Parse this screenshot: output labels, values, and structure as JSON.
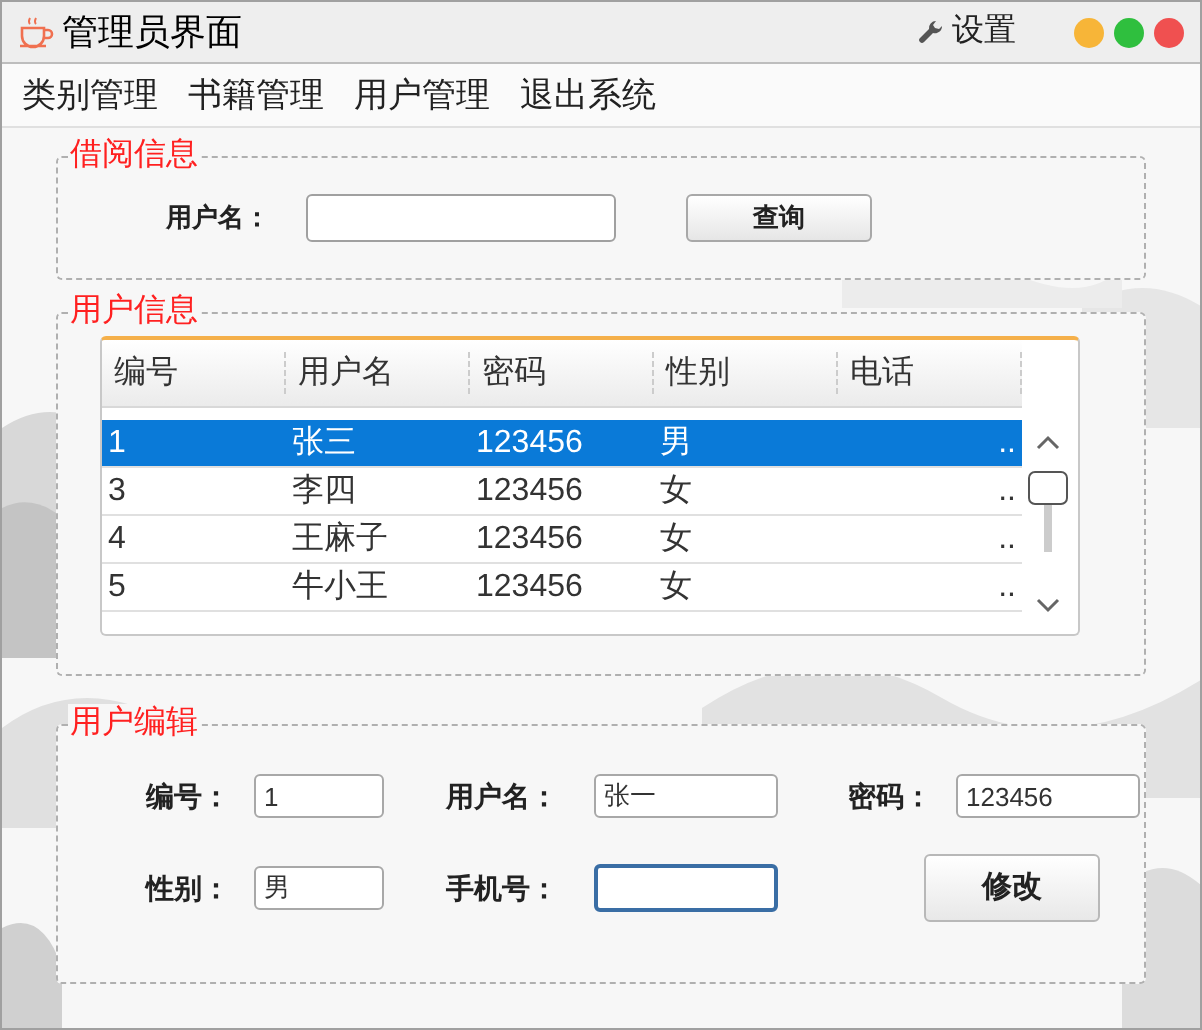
{
  "window": {
    "title": "管理员界面",
    "settings": "设置"
  },
  "menu": [
    "类别管理",
    "书籍管理",
    "用户管理",
    "退出系统"
  ],
  "borrow": {
    "title": "借阅信息",
    "label": "用户名：",
    "button": "查询"
  },
  "users": {
    "title": "用户信息",
    "columns": [
      "编号",
      "用户名",
      "密码",
      "性别",
      "电话"
    ],
    "rows": [
      {
        "cells": [
          "1",
          "张三",
          "123456",
          "男",
          ".."
        ],
        "selected": true
      },
      {
        "cells": [
          "3",
          "李四",
          "123456",
          "女",
          ".."
        ],
        "selected": false
      },
      {
        "cells": [
          "4",
          "王麻子",
          "123456",
          "女",
          ".."
        ],
        "selected": false
      },
      {
        "cells": [
          "5",
          "牛小王",
          "123456",
          "女",
          ".."
        ],
        "selected": false
      }
    ]
  },
  "edit": {
    "title": "用户编辑",
    "fields": [
      {
        "label": "编号：",
        "value": "1"
      },
      {
        "label": "用户名：",
        "value": "张一"
      },
      {
        "label": "密码：",
        "value": "123456"
      },
      {
        "label": "性别：",
        "value": "男"
      },
      {
        "label": "手机号：",
        "focused": true
      }
    ],
    "button": "修改"
  }
}
